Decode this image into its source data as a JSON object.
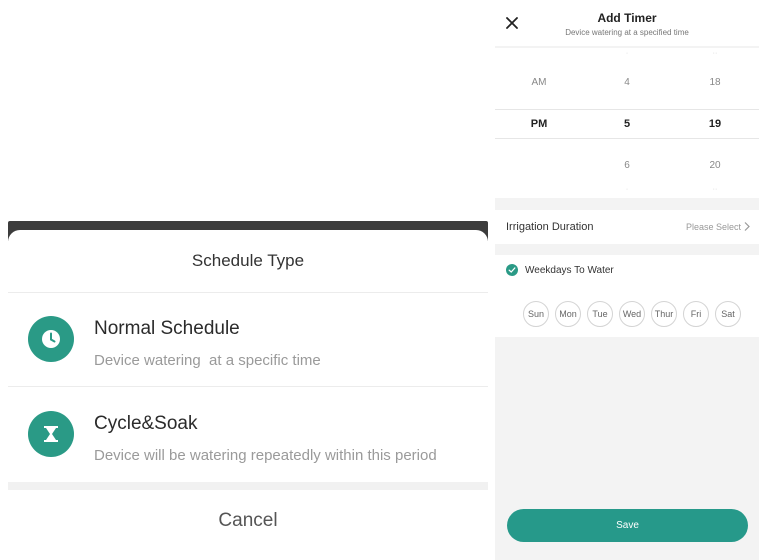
{
  "schedule_sheet": {
    "title": "Schedule Type",
    "options": [
      {
        "title": "Normal Schedule",
        "description": "Device watering  at a specific time",
        "icon": "clock-icon"
      },
      {
        "title": "Cycle&Soak",
        "description": "Device will be watering repeatedly within this period",
        "icon": "hourglass-icon"
      }
    ],
    "cancel_label": "Cancel"
  },
  "add_timer": {
    "title": "Add Timer",
    "subtitle": "Device watering at a specified time",
    "picker": {
      "period": {
        "above": "AM",
        "selected": "PM"
      },
      "hour": {
        "above": "4",
        "selected": "5",
        "below": "6"
      },
      "minute": {
        "above": "18",
        "selected": "19",
        "below": "20"
      }
    },
    "duration": {
      "label": "Irrigation Duration",
      "value": "Please Select"
    },
    "weekdays": {
      "label": "Weekdays To Water",
      "days": [
        "Sun",
        "Mon",
        "Tue",
        "Wed",
        "Thur",
        "Fri",
        "Sat"
      ]
    },
    "save_label": "Save"
  },
  "colors": {
    "accent": "#2a9a86",
    "save_button": "#26998a"
  }
}
